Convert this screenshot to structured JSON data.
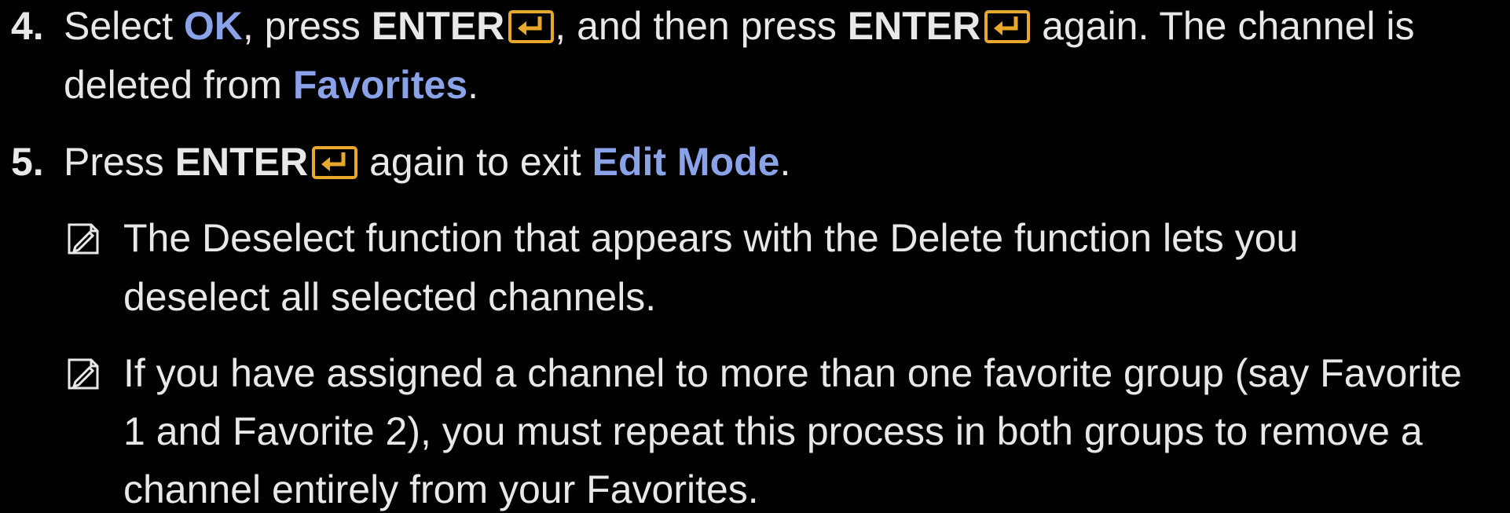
{
  "colors": {
    "background": "#000000",
    "text": "#e8e8e8",
    "highlight": "#8aa3e8",
    "enter_icon": "#e8a82c"
  },
  "steps": [
    {
      "number": "4.",
      "line1": {
        "t1": "Select ",
        "ok": "OK",
        "t2": ", press ",
        "enter1": "ENTER",
        "t3": ", and then press ",
        "enter2": "ENTER",
        "t4": " again. The channel is"
      },
      "line2": {
        "t1": "deleted from ",
        "favorites": "Favorites",
        "t2": "."
      }
    },
    {
      "number": "5.",
      "line1": {
        "t1": "Press ",
        "enter": "ENTER",
        "t2": " again to exit ",
        "edit_mode": "Edit Mode",
        "t3": "."
      }
    }
  ],
  "notes": [
    {
      "icon": "note-icon",
      "lines": [
        "The Deselect function that appears with the Delete function lets you",
        "deselect all selected channels."
      ]
    },
    {
      "icon": "note-icon",
      "lines": [
        "If you have assigned a channel to more than one favorite group (say Favorite",
        "1 and Favorite 2), you must repeat this process in both groups to remove a",
        "channel entirely from your Favorites."
      ]
    }
  ]
}
